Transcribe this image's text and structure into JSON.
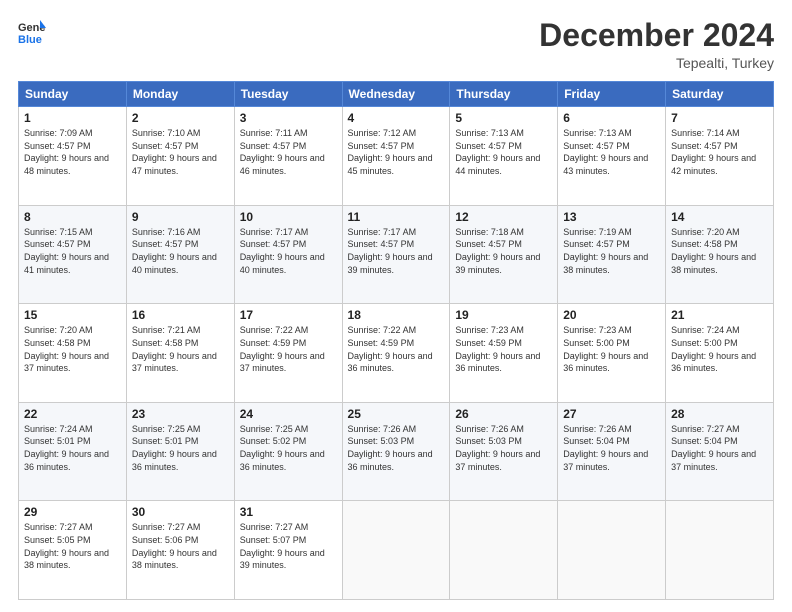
{
  "logo": {
    "line1": "General",
    "line2": "Blue"
  },
  "title": "December 2024",
  "subtitle": "Tepealti, Turkey",
  "header_days": [
    "Sunday",
    "Monday",
    "Tuesday",
    "Wednesday",
    "Thursday",
    "Friday",
    "Saturday"
  ],
  "weeks": [
    [
      {
        "day": "1",
        "sunrise": "Sunrise: 7:09 AM",
        "sunset": "Sunset: 4:57 PM",
        "daylight": "Daylight: 9 hours and 48 minutes."
      },
      {
        "day": "2",
        "sunrise": "Sunrise: 7:10 AM",
        "sunset": "Sunset: 4:57 PM",
        "daylight": "Daylight: 9 hours and 47 minutes."
      },
      {
        "day": "3",
        "sunrise": "Sunrise: 7:11 AM",
        "sunset": "Sunset: 4:57 PM",
        "daylight": "Daylight: 9 hours and 46 minutes."
      },
      {
        "day": "4",
        "sunrise": "Sunrise: 7:12 AM",
        "sunset": "Sunset: 4:57 PM",
        "daylight": "Daylight: 9 hours and 45 minutes."
      },
      {
        "day": "5",
        "sunrise": "Sunrise: 7:13 AM",
        "sunset": "Sunset: 4:57 PM",
        "daylight": "Daylight: 9 hours and 44 minutes."
      },
      {
        "day": "6",
        "sunrise": "Sunrise: 7:13 AM",
        "sunset": "Sunset: 4:57 PM",
        "daylight": "Daylight: 9 hours and 43 minutes."
      },
      {
        "day": "7",
        "sunrise": "Sunrise: 7:14 AM",
        "sunset": "Sunset: 4:57 PM",
        "daylight": "Daylight: 9 hours and 42 minutes."
      }
    ],
    [
      {
        "day": "8",
        "sunrise": "Sunrise: 7:15 AM",
        "sunset": "Sunset: 4:57 PM",
        "daylight": "Daylight: 9 hours and 41 minutes."
      },
      {
        "day": "9",
        "sunrise": "Sunrise: 7:16 AM",
        "sunset": "Sunset: 4:57 PM",
        "daylight": "Daylight: 9 hours and 40 minutes."
      },
      {
        "day": "10",
        "sunrise": "Sunrise: 7:17 AM",
        "sunset": "Sunset: 4:57 PM",
        "daylight": "Daylight: 9 hours and 40 minutes."
      },
      {
        "day": "11",
        "sunrise": "Sunrise: 7:17 AM",
        "sunset": "Sunset: 4:57 PM",
        "daylight": "Daylight: 9 hours and 39 minutes."
      },
      {
        "day": "12",
        "sunrise": "Sunrise: 7:18 AM",
        "sunset": "Sunset: 4:57 PM",
        "daylight": "Daylight: 9 hours and 39 minutes."
      },
      {
        "day": "13",
        "sunrise": "Sunrise: 7:19 AM",
        "sunset": "Sunset: 4:57 PM",
        "daylight": "Daylight: 9 hours and 38 minutes."
      },
      {
        "day": "14",
        "sunrise": "Sunrise: 7:20 AM",
        "sunset": "Sunset: 4:58 PM",
        "daylight": "Daylight: 9 hours and 38 minutes."
      }
    ],
    [
      {
        "day": "15",
        "sunrise": "Sunrise: 7:20 AM",
        "sunset": "Sunset: 4:58 PM",
        "daylight": "Daylight: 9 hours and 37 minutes."
      },
      {
        "day": "16",
        "sunrise": "Sunrise: 7:21 AM",
        "sunset": "Sunset: 4:58 PM",
        "daylight": "Daylight: 9 hours and 37 minutes."
      },
      {
        "day": "17",
        "sunrise": "Sunrise: 7:22 AM",
        "sunset": "Sunset: 4:59 PM",
        "daylight": "Daylight: 9 hours and 37 minutes."
      },
      {
        "day": "18",
        "sunrise": "Sunrise: 7:22 AM",
        "sunset": "Sunset: 4:59 PM",
        "daylight": "Daylight: 9 hours and 36 minutes."
      },
      {
        "day": "19",
        "sunrise": "Sunrise: 7:23 AM",
        "sunset": "Sunset: 4:59 PM",
        "daylight": "Daylight: 9 hours and 36 minutes."
      },
      {
        "day": "20",
        "sunrise": "Sunrise: 7:23 AM",
        "sunset": "Sunset: 5:00 PM",
        "daylight": "Daylight: 9 hours and 36 minutes."
      },
      {
        "day": "21",
        "sunrise": "Sunrise: 7:24 AM",
        "sunset": "Sunset: 5:00 PM",
        "daylight": "Daylight: 9 hours and 36 minutes."
      }
    ],
    [
      {
        "day": "22",
        "sunrise": "Sunrise: 7:24 AM",
        "sunset": "Sunset: 5:01 PM",
        "daylight": "Daylight: 9 hours and 36 minutes."
      },
      {
        "day": "23",
        "sunrise": "Sunrise: 7:25 AM",
        "sunset": "Sunset: 5:01 PM",
        "daylight": "Daylight: 9 hours and 36 minutes."
      },
      {
        "day": "24",
        "sunrise": "Sunrise: 7:25 AM",
        "sunset": "Sunset: 5:02 PM",
        "daylight": "Daylight: 9 hours and 36 minutes."
      },
      {
        "day": "25",
        "sunrise": "Sunrise: 7:26 AM",
        "sunset": "Sunset: 5:03 PM",
        "daylight": "Daylight: 9 hours and 36 minutes."
      },
      {
        "day": "26",
        "sunrise": "Sunrise: 7:26 AM",
        "sunset": "Sunset: 5:03 PM",
        "daylight": "Daylight: 9 hours and 37 minutes."
      },
      {
        "day": "27",
        "sunrise": "Sunrise: 7:26 AM",
        "sunset": "Sunset: 5:04 PM",
        "daylight": "Daylight: 9 hours and 37 minutes."
      },
      {
        "day": "28",
        "sunrise": "Sunrise: 7:27 AM",
        "sunset": "Sunset: 5:04 PM",
        "daylight": "Daylight: 9 hours and 37 minutes."
      }
    ],
    [
      {
        "day": "29",
        "sunrise": "Sunrise: 7:27 AM",
        "sunset": "Sunset: 5:05 PM",
        "daylight": "Daylight: 9 hours and 38 minutes."
      },
      {
        "day": "30",
        "sunrise": "Sunrise: 7:27 AM",
        "sunset": "Sunset: 5:06 PM",
        "daylight": "Daylight: 9 hours and 38 minutes."
      },
      {
        "day": "31",
        "sunrise": "Sunrise: 7:27 AM",
        "sunset": "Sunset: 5:07 PM",
        "daylight": "Daylight: 9 hours and 39 minutes."
      },
      null,
      null,
      null,
      null
    ]
  ]
}
